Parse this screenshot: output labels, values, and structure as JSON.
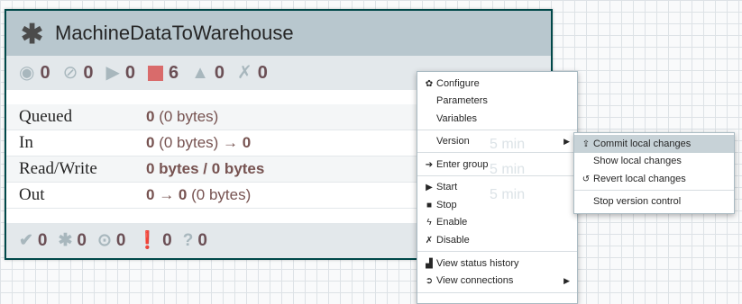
{
  "process_group": {
    "title": "MachineDataToWarehouse",
    "stats": [
      {
        "icon": "transmitting-icon",
        "count": "0"
      },
      {
        "icon": "not-transmitting-icon",
        "count": "0"
      },
      {
        "icon": "running-icon",
        "count": "0"
      },
      {
        "icon": "stopped-icon",
        "count": "6"
      },
      {
        "icon": "invalid-icon",
        "count": "0"
      },
      {
        "icon": "disabled-icon",
        "count": "0"
      }
    ],
    "rows": [
      {
        "label": "Queued",
        "value_bold": "0",
        "value_rest": " (0 bytes)"
      },
      {
        "label": "In",
        "value_bold": "0",
        "value_rest": " (0 bytes) → ",
        "value_bold2": "0"
      },
      {
        "label": "Read/Write",
        "value_bold": "0 bytes / 0 bytes",
        "value_rest": ""
      },
      {
        "label": "Out",
        "value_bold": "0",
        "value_rest": " → ",
        "value_bold2": "0",
        "value_rest2": " (0 bytes)"
      }
    ],
    "footer": [
      {
        "icon": "up-to-date-icon",
        "count": "0"
      },
      {
        "icon": "locally-modified-icon",
        "count": "0"
      },
      {
        "icon": "stale-icon",
        "count": "0"
      },
      {
        "icon": "locally-modified-and-stale-icon",
        "count": "0"
      },
      {
        "icon": "sync-failure-icon",
        "count": "0"
      }
    ],
    "ghost_text": [
      "5 min",
      "5 min",
      "5 min"
    ]
  },
  "context_menu": {
    "items": [
      {
        "label": "Configure",
        "icon": "gear-icon"
      },
      {
        "label": "Parameters",
        "icon": ""
      },
      {
        "label": "Variables",
        "icon": ""
      },
      {
        "label": "Version",
        "icon": "",
        "submenu": true
      },
      {
        "label": "Enter group",
        "icon": "enter-icon"
      },
      {
        "label": "Start",
        "icon": "play-icon"
      },
      {
        "label": "Stop",
        "icon": "stop-icon"
      },
      {
        "label": "Enable",
        "icon": "enable-icon"
      },
      {
        "label": "Disable",
        "icon": "disable-icon"
      },
      {
        "label": "View status history",
        "icon": "chart-icon"
      },
      {
        "label": "View connections",
        "icon": "connections-icon",
        "submenu": true
      }
    ]
  },
  "version_submenu": {
    "items": [
      {
        "label": "Commit local changes",
        "icon": "upload-icon",
        "highlighted": true
      },
      {
        "label": "Show local changes",
        "icon": ""
      },
      {
        "label": "Revert local changes",
        "icon": "undo-icon"
      },
      {
        "label": "Stop version control",
        "icon": ""
      }
    ]
  },
  "colors": {
    "header_bg": "#b8c7ce",
    "border": "#004849",
    "value_text": "#775351",
    "stopped_red": "#d96b6b",
    "highlight": "#c7d2d7"
  }
}
